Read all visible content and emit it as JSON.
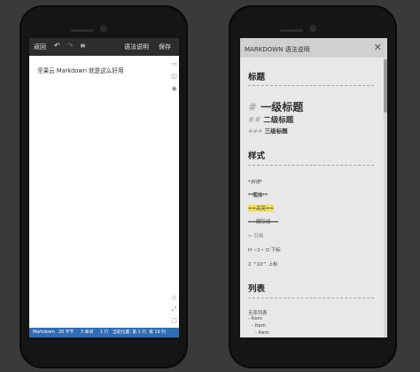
{
  "editor": {
    "toolbar": {
      "back": "返回",
      "syntax": "语法说明",
      "save": "保存"
    },
    "content": "坚果云 Markdown 就是这么好用",
    "status": {
      "mode": "Markdown",
      "chars": "20 字节",
      "lines": "3 单词",
      "rows": "1 行",
      "position": "当前位置: 第 1 行, 第 19 列"
    }
  },
  "syntax_panel": {
    "title": "MARKDOWN 语法说明",
    "sections": {
      "headings": {
        "title": "标题",
        "h1_hash": "#",
        "h1": "一级标题",
        "h2_hash": "##",
        "h2": "二级标题",
        "h3_hash": "###",
        "h3": "三级标题"
      },
      "styles": {
        "title": "样式",
        "italic": "*斜体*",
        "bold": "**粗体**",
        "highlight": "==高亮==",
        "strike": "~~删除线~~",
        "quote": "> 引用",
        "sub": "H ~2~ O 下标",
        "sup": "2 ^10^ 上标"
      },
      "lists": {
        "title": "列表",
        "unordered": "无序列表",
        "item1": "- Item",
        "item2": "- Item",
        "item3": "- Item"
      }
    }
  }
}
